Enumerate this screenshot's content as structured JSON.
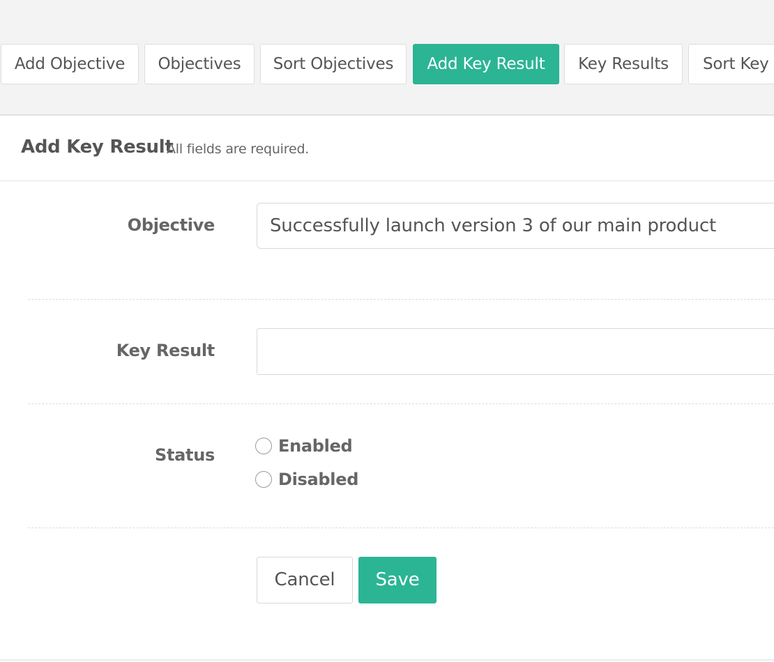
{
  "tabs": [
    {
      "label": "Add Objective",
      "active": false
    },
    {
      "label": "Objectives",
      "active": false
    },
    {
      "label": "Sort Objectives",
      "active": false
    },
    {
      "label": "Add Key Result",
      "active": true
    },
    {
      "label": "Key Results",
      "active": false
    },
    {
      "label": "Sort Key I",
      "active": false
    }
  ],
  "header": {
    "title": "Add Key Result",
    "subtitle": "All fields are required."
  },
  "form": {
    "objective": {
      "label": "Objective",
      "selected_value": "Successfully launch version 3 of our main product"
    },
    "key_result": {
      "label": "Key Result",
      "value": ""
    },
    "status": {
      "label": "Status",
      "options": [
        "Enabled",
        "Disabled"
      ],
      "selected": null
    }
  },
  "actions": {
    "cancel_label": "Cancel",
    "save_label": "Save"
  },
  "colors": {
    "accent": "#2bb594",
    "topbar_background": "#f3f3f3",
    "text": "#555555"
  }
}
